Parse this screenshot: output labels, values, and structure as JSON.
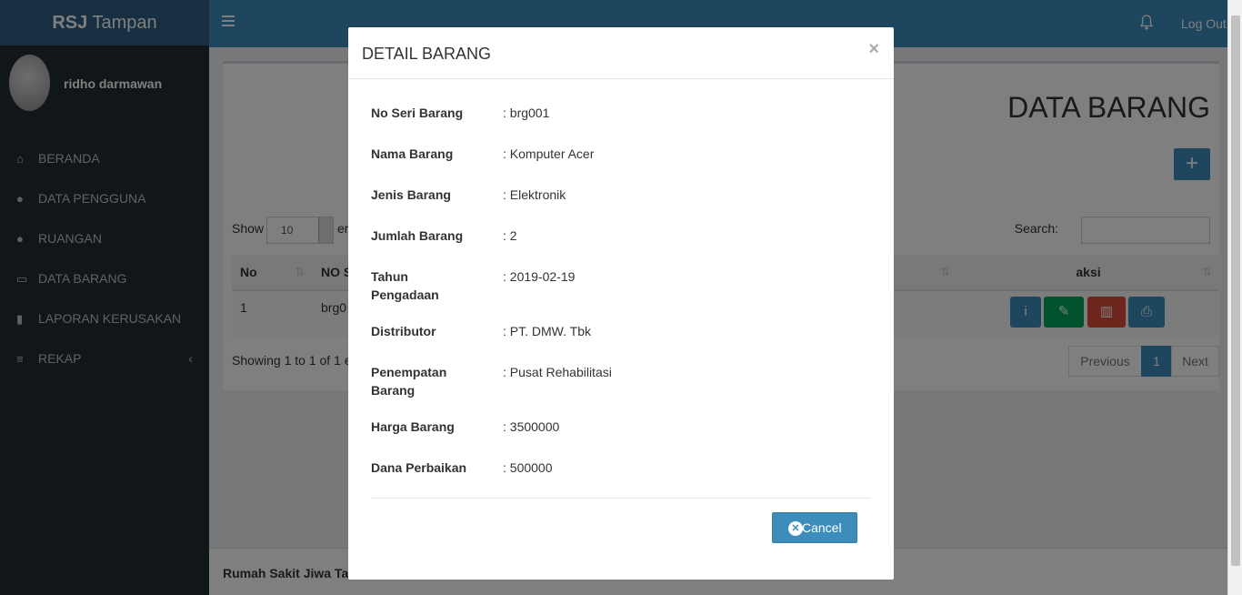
{
  "app": {
    "brand_bold": "RSJ",
    "brand_rest": "Tampan",
    "logout": "Log Out"
  },
  "user": {
    "name": "ridho darmawan"
  },
  "sidebar": {
    "items": [
      {
        "label": "BERANDA",
        "icon": "home-icon"
      },
      {
        "label": "DATA PENGGUNA",
        "icon": "user-icon"
      },
      {
        "label": "RUANGAN",
        "icon": "user-icon"
      },
      {
        "label": "DATA BARANG",
        "icon": "folder-icon"
      },
      {
        "label": "LAPORAN KERUSAKAN",
        "icon": "file-icon"
      },
      {
        "label": "REKAP",
        "icon": "database-icon",
        "arrow": "‹"
      }
    ]
  },
  "main": {
    "title": "DATA BARANG",
    "show_label": "Show",
    "show_value": "10",
    "entries_label": "en",
    "search_label": "Search:",
    "columns": {
      "no": "No",
      "no_seri": "NO S",
      "aksi": "aksi"
    },
    "row": {
      "no": "1",
      "no_seri": "brg0"
    },
    "showing": "Showing 1 to 1 of 1 e",
    "pagination": {
      "previous": "Previous",
      "current": "1",
      "next": "Next"
    }
  },
  "footer": {
    "text": "Rumah Sakit Jiwa Ta"
  },
  "modal": {
    "title": "DETAIL BARANG",
    "close": "×",
    "fields": [
      {
        "label": "No Seri Barang",
        "value": ": brg001"
      },
      {
        "label": "Nama Barang",
        "value": ": Komputer Acer"
      },
      {
        "label": "Jenis Barang",
        "value": ": Elektronik"
      },
      {
        "label": "Jumlah Barang",
        "value": ": 2"
      },
      {
        "label": "Tahun Pengadaan",
        "value": ": 2019-02-19"
      },
      {
        "label": "Distributor",
        "value": ": PT. DMW. Tbk"
      },
      {
        "label": "Penempatan Barang",
        "value": ": Pusat Rehabilitasi"
      },
      {
        "label": "Harga Barang",
        "value": ": 3500000"
      },
      {
        "label": "Dana Perbaikan",
        "value": ": 500000"
      }
    ],
    "cancel": "Cancel"
  },
  "colors": {
    "primary": "#3c8dbc",
    "success": "#00a65a",
    "danger": "#dd4b39",
    "sidebar": "#222d32"
  }
}
